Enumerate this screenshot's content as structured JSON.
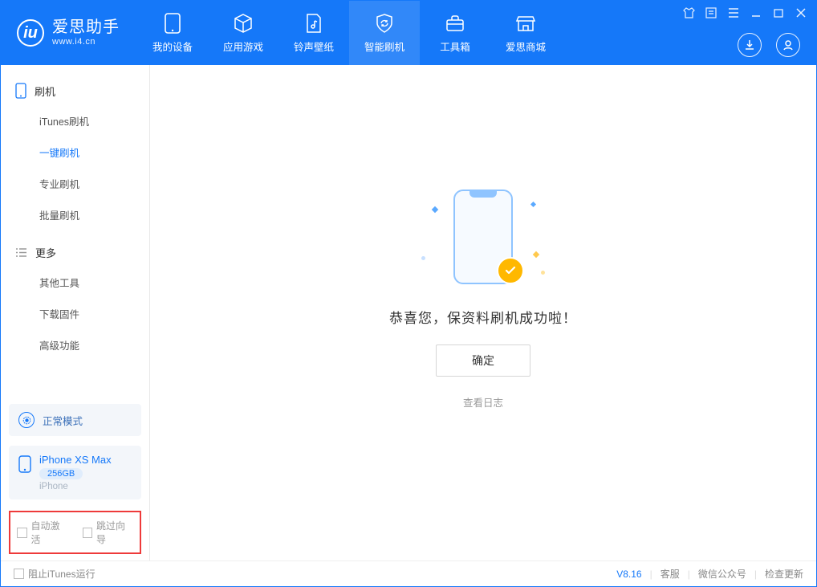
{
  "brand": {
    "main": "爱思助手",
    "sub": "www.i4.cn"
  },
  "tabs": {
    "device": "我的设备",
    "apps": "应用游戏",
    "ringtone": "铃声壁纸",
    "flash": "智能刷机",
    "toolbox": "工具箱",
    "store": "爱思商城"
  },
  "sidebar": {
    "group1_title": "刷机",
    "group1": {
      "itunes": "iTunes刷机",
      "oneclick": "一键刷机",
      "pro": "专业刷机",
      "batch": "批量刷机"
    },
    "group2_title": "更多",
    "group2": {
      "tools": "其他工具",
      "firmware": "下载固件",
      "advanced": "高级功能"
    }
  },
  "mode": {
    "label": "正常模式"
  },
  "device": {
    "name": "iPhone XS Max",
    "storage": "256GB",
    "type": "iPhone"
  },
  "options": {
    "auto_activate": "自动激活",
    "skip_wizard": "跳过向导"
  },
  "main": {
    "success": "恭喜您，保资料刷机成功啦！",
    "confirm": "确定",
    "log": "查看日志"
  },
  "footer": {
    "block_itunes": "阻止iTunes运行",
    "version": "V8.16",
    "support": "客服",
    "wechat": "微信公众号",
    "update": "检查更新"
  }
}
